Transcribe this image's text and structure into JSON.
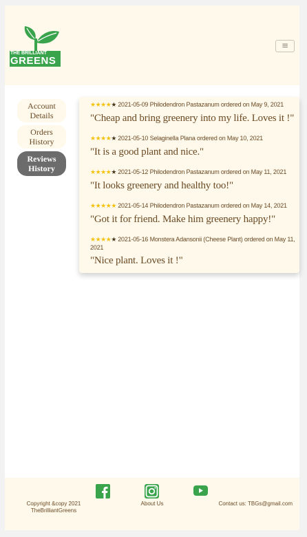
{
  "brand": {
    "logo_line1": "THE BRILLIANT",
    "logo_line2": "GREENS"
  },
  "header": {
    "menu_icon": "≡"
  },
  "sidebar": {
    "items": [
      {
        "label": "Account Details",
        "active": false
      },
      {
        "label": "Orders History",
        "active": false
      },
      {
        "label": "Reviews History",
        "active": true
      }
    ]
  },
  "reviews": [
    {
      "rating": 4,
      "date": "2021-05-09",
      "meta": "Philodendron Pastazanum ordered on May 9, 2021",
      "quote": "\"Cheap and bring greenery into my life. Loves it !\""
    },
    {
      "rating": 4,
      "date": "2021-05-10",
      "meta": "Selaginella Plana ordered on May 10, 2021",
      "quote": "\"It is a good plant and nice.\""
    },
    {
      "rating": 4,
      "date": "2021-05-12",
      "meta": "Philodendron Pastazanum ordered on May 11, 2021",
      "quote": "\"It looks greenery and healthy too!\""
    },
    {
      "rating": 5,
      "date": "2021-05-14",
      "meta": "Philodendron Pastazanum ordered on May 14, 2021",
      "quote": "\"Got it for friend. Make him greenery happy!\""
    },
    {
      "rating": 4,
      "date": "2021-05-16",
      "meta": "Monstera Adansonii (Cheese Plant) ordered on May 11, 2021",
      "quote": "\"Nice plant. Loves it !\""
    }
  ],
  "footer": {
    "copyright": "Copyright &copy 2021 TheBrilliantGreens",
    "about": "About Us",
    "contact": "Contact us: TBGs@gmail.com",
    "icons": [
      "facebook-icon",
      "instagram-icon",
      "youtube-icon"
    ]
  },
  "colors": {
    "cream": "#fff9ec",
    "brown_text": "#6a4a23",
    "brand_green": "#3aa44c",
    "star_yellow": "#f4c20d",
    "active_nav": "#6c6c6c"
  }
}
